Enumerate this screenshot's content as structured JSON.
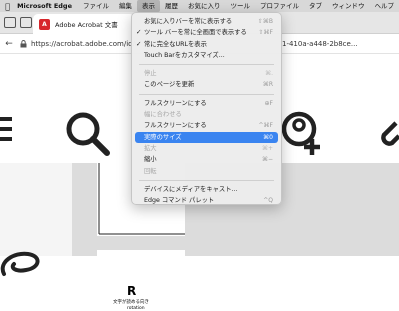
{
  "menubar": {
    "app_name": "Microsoft Edge",
    "items": [
      "ファイル",
      "編集",
      "表示",
      "履歴",
      "お気に入り",
      "ツール",
      "プロファイル",
      "タブ",
      "ウィンドウ",
      "ヘルプ"
    ]
  },
  "tab": {
    "title": "Adobe Acrobat 文書",
    "badge": "A"
  },
  "address": {
    "url": "https://acrobat.adobe.com/id/u",
    "url_tail": "1-410a-a448-2b8ce..."
  },
  "view_menu": {
    "group1": [
      {
        "label": "お気に入りバーを常に表示する",
        "shortcut": "⇧⌘B",
        "checked": false,
        "disabled": false
      },
      {
        "label": "ツール バーを常に全画面で表示する",
        "shortcut": "⇧⌘F",
        "checked": true,
        "disabled": false
      },
      {
        "label": "常に完全なURLを表示",
        "shortcut": "",
        "checked": true,
        "disabled": false
      },
      {
        "label": "Touch Barをカスタマイズ...",
        "shortcut": "",
        "checked": false,
        "disabled": false
      }
    ],
    "group2": [
      {
        "label": "停止",
        "shortcut": "⌘.",
        "disabled": true
      },
      {
        "label": "このページを更新",
        "shortcut": "⌘R",
        "disabled": false
      }
    ],
    "group3": [
      {
        "label": "フルスクリーンにする",
        "shortcut": "⊕F",
        "disabled": false
      },
      {
        "label": "幅に合わせる",
        "shortcut": "",
        "disabled": true
      },
      {
        "label": "フルスクリーンにする",
        "shortcut": "^⌘F",
        "disabled": false
      },
      {
        "label": "実際のサイズ",
        "shortcut": "⌘0",
        "disabled": false,
        "highlighted": true
      },
      {
        "label": "拡大",
        "shortcut": "⌘+",
        "disabled": true
      },
      {
        "label": "縮小",
        "shortcut": "⌘−",
        "disabled": false
      },
      {
        "label": "回転",
        "shortcut": "",
        "disabled": true
      }
    ],
    "group4": [
      {
        "label": "デバイスにメディアをキャスト...",
        "shortcut": "",
        "disabled": false
      },
      {
        "label": "Edge コマンド パレット",
        "shortcut": "^Q",
        "disabled": false
      }
    ]
  },
  "page": {
    "heading_letter": "R",
    "line1": "文字が読める向き",
    "line2": "rotation"
  },
  "colors": {
    "highlight": "#3a84f0",
    "pdf_red": "#d7262c"
  }
}
